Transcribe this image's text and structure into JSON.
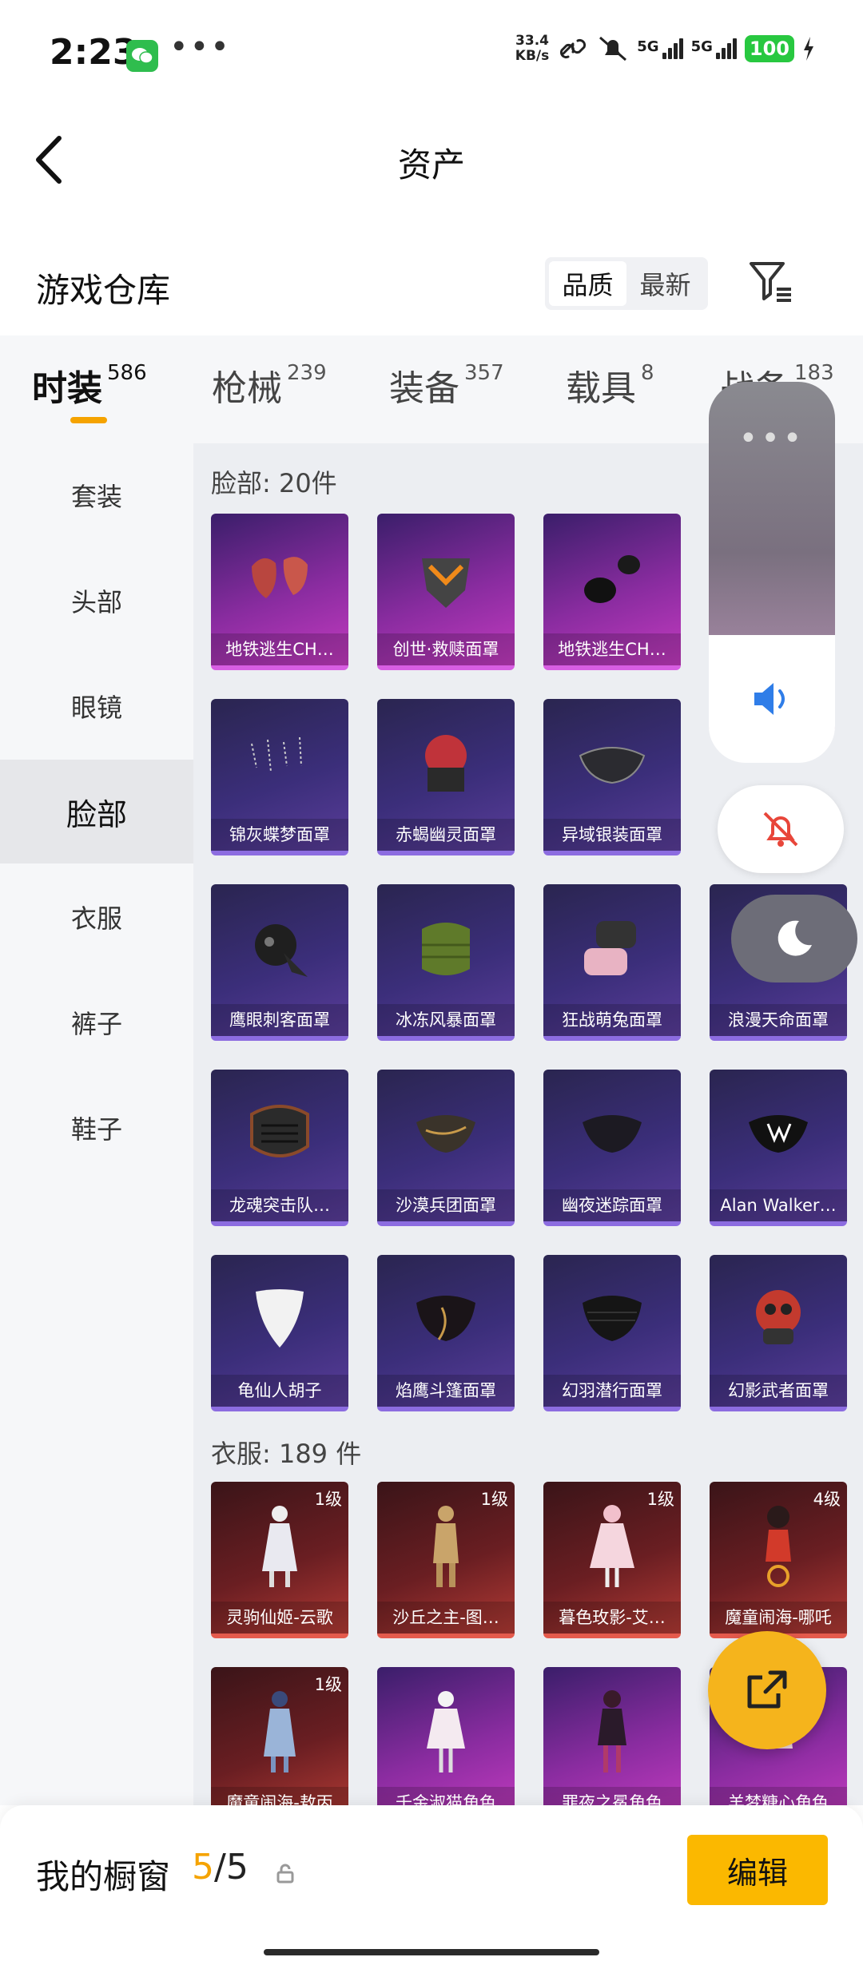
{
  "status_bar": {
    "time": "2:23",
    "net_speed_value": "33.4",
    "net_speed_unit": "KB/s",
    "signal1": "5G",
    "signal2": "5G",
    "battery": "100"
  },
  "header": {
    "title": "资产"
  },
  "warehouse": {
    "title": "游戏仓库",
    "sort_options": [
      "品质",
      "最新"
    ],
    "sort_active": "品质"
  },
  "tabs": [
    {
      "name": "时装",
      "count": "586"
    },
    {
      "name": "枪械",
      "count": "239"
    },
    {
      "name": "装备",
      "count": "357"
    },
    {
      "name": "载具",
      "count": "8"
    },
    {
      "name": "战备",
      "count": "183"
    }
  ],
  "side_menu": [
    "套装",
    "头部",
    "眼镜",
    "脸部",
    "衣服",
    "裤子",
    "鞋子"
  ],
  "sections": {
    "face": {
      "title": "脸部: 20件",
      "items": [
        "地铁逃生CH…",
        "创世·救赎面罩",
        "地铁逃生CH…",
        "锦灰蝶梦面罩",
        "赤蝎幽灵面罩",
        "异域银装面罩",
        "鹰眼刺客面罩",
        "冰冻风暴面罩",
        "狂战萌兔面罩",
        "浪漫天命面罩",
        "龙魂突击队…",
        "沙漠兵团面罩",
        "幽夜迷踪面罩",
        "Alan Walker…",
        "龟仙人胡子",
        "焰鹰斗篷面罩",
        "幻羽潜行面罩",
        "幻影武者面罩"
      ]
    },
    "clothes": {
      "title": "衣服: 189 件",
      "items": [
        {
          "name": "灵驹仙姬-云歌",
          "level": "1级"
        },
        {
          "name": "沙丘之主-图…",
          "level": "1级"
        },
        {
          "name": "暮色玫影-艾…",
          "level": "1级"
        },
        {
          "name": "魔童闹海-哪吒",
          "level": "4级"
        },
        {
          "name": "魔童闹海-敖丙",
          "level": "1级"
        },
        {
          "name": "千金淑猫角色",
          "level": ""
        },
        {
          "name": "罪夜之冕角色",
          "level": ""
        },
        {
          "name": "羊梦糖心角色",
          "level": ""
        }
      ]
    }
  },
  "bottom_bar": {
    "title": "我的橱窗",
    "count_current": "5",
    "count_sep": "/",
    "count_total": "5",
    "edit_label": "编辑"
  }
}
